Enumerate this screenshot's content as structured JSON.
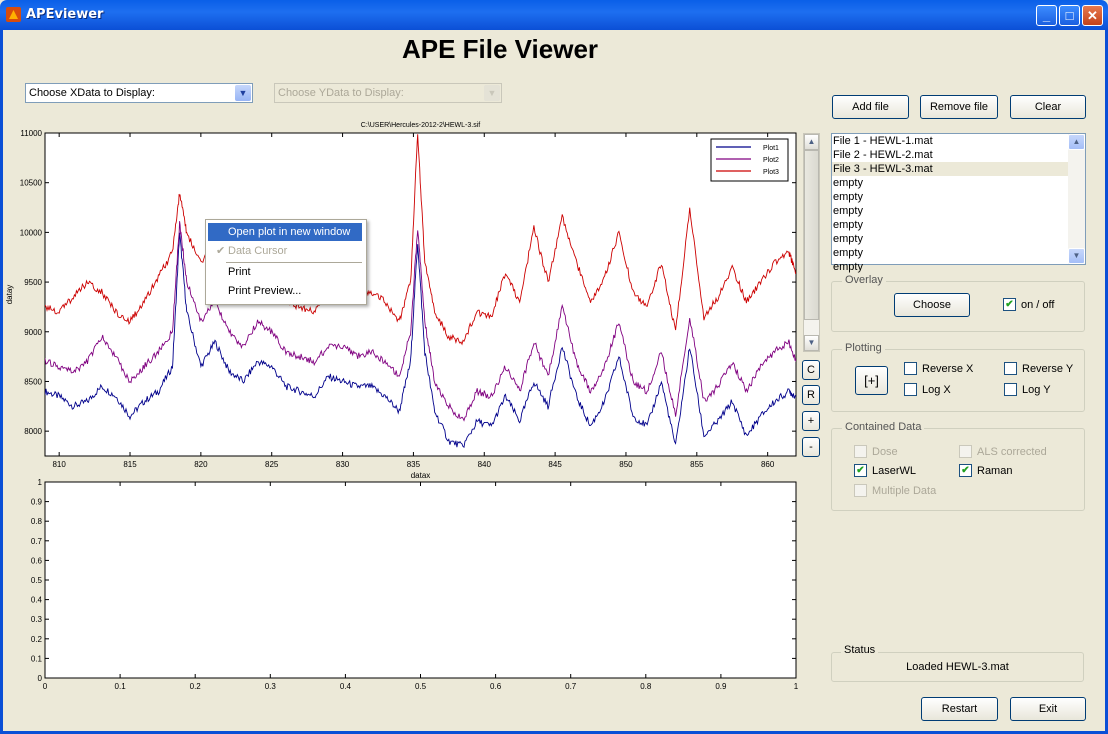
{
  "window": {
    "title": "APEviewer"
  },
  "main_title": "APE File Viewer",
  "xdata_select": {
    "value": "Choose XData to Display:"
  },
  "ydata_select": {
    "value": "Choose YData to Display:"
  },
  "buttons": {
    "add": "Add file",
    "remove": "Remove file",
    "clear": "Clear",
    "restart": "Restart",
    "exit": "Exit",
    "choose": "Choose",
    "zoom": "[+]"
  },
  "side_buttons": [
    "C",
    "R",
    "+",
    "-"
  ],
  "files": [
    "File 1 - HEWL-1.mat",
    "File 2 - HEWL-2.mat",
    "File 3 - HEWL-3.mat",
    "empty",
    "empty",
    "empty",
    "empty",
    "empty",
    "empty",
    "empty"
  ],
  "selected_file_index": 2,
  "overlay": {
    "label": "Overlay",
    "toggle_label": "on / off",
    "toggle_checked": true
  },
  "plotting": {
    "label": "Plotting",
    "reverse_x": "Reverse X",
    "reverse_y": "Reverse Y",
    "log_x": "Log X",
    "log_y": "Log Y"
  },
  "contained": {
    "label": "Contained Data",
    "dose": "Dose",
    "als": "ALS corrected",
    "laser": "LaserWL",
    "raman": "Raman",
    "multiple": "Multiple Data",
    "laser_checked": true,
    "raman_checked": true
  },
  "status": {
    "label": "Status",
    "text": "Loaded HEWL-3.mat"
  },
  "context_menu": {
    "items": [
      "Open plot in new window",
      "Data Cursor",
      "Print",
      "Print Preview..."
    ]
  },
  "colors": {
    "plot1": "#00008B",
    "plot2": "#800080",
    "plot3": "#CC0000",
    "menu_highlight": "#316AC5"
  },
  "chart_data": [
    {
      "type": "line",
      "title": "C:\\USER\\Hercules-2012-2\\HEWL-3.sif",
      "xlabel": "datax",
      "ylabel": "datay",
      "xlim": [
        809,
        862
      ],
      "ylim": [
        7750,
        11000
      ],
      "xticks": [
        810,
        815,
        820,
        825,
        830,
        835,
        840,
        845,
        850,
        855,
        860
      ],
      "yticks": [
        8000,
        8500,
        9000,
        9500,
        10000,
        10500,
        11000
      ],
      "legend": "top-right",
      "x": [
        809,
        810,
        811,
        812,
        813,
        814,
        815,
        816,
        817,
        818,
        818.5,
        819,
        820,
        821,
        822,
        823,
        824,
        825,
        826,
        827,
        828,
        829,
        830,
        831,
        832,
        833,
        834,
        834.8,
        835.3,
        835.8,
        836.5,
        837.5,
        838.5,
        839.5,
        840.5,
        841.5,
        842.5,
        843.5,
        844.5,
        845.5,
        846.5,
        847.5,
        848.5,
        849.5,
        850.5,
        851.5,
        852.5,
        853.5,
        854.5,
        855.5,
        856.5,
        857.5,
        858.5,
        859.5,
        860.5,
        861.5,
        862
      ],
      "series": [
        {
          "name": "Plot1",
          "values": [
            8400,
            8350,
            8250,
            8300,
            8450,
            8350,
            8150,
            8300,
            8400,
            8650,
            10000,
            9200,
            8650,
            8900,
            8600,
            8500,
            8700,
            8650,
            8450,
            8400,
            8350,
            8550,
            8500,
            8450,
            8450,
            8350,
            8200,
            8700,
            9900,
            8800,
            8200,
            7900,
            7850,
            8100,
            8050,
            8350,
            8100,
            8500,
            8250,
            8850,
            8350,
            8050,
            8300,
            8750,
            8150,
            8050,
            8500,
            7850,
            8850,
            7950,
            8100,
            8300,
            7950,
            8150,
            8300,
            8400,
            8350
          ]
        },
        {
          "name": "Plot2",
          "values": [
            8700,
            8650,
            8600,
            8700,
            8950,
            8750,
            8500,
            8650,
            8800,
            9000,
            10100,
            9500,
            9100,
            9300,
            9000,
            8850,
            9100,
            9000,
            8800,
            8750,
            8700,
            8850,
            8850,
            8750,
            8800,
            8700,
            8550,
            9000,
            10050,
            9100,
            8500,
            8250,
            8100,
            8400,
            8350,
            8650,
            8400,
            8900,
            8550,
            9250,
            8700,
            8400,
            8650,
            9100,
            8500,
            8400,
            8800,
            8150,
            9150,
            8300,
            8450,
            8700,
            8400,
            8650,
            8800,
            8900,
            8700
          ]
        },
        {
          "name": "Plot3",
          "values": [
            9250,
            9200,
            9350,
            9500,
            9400,
            9200,
            9100,
            9300,
            9550,
            9800,
            10400,
            10000,
            9700,
            9900,
            9500,
            9300,
            9600,
            9550,
            9300,
            9250,
            9200,
            9450,
            9450,
            9300,
            9400,
            9300,
            9100,
            9500,
            11000,
            9700,
            9200,
            8950,
            8900,
            9200,
            9150,
            9600,
            9300,
            10050,
            9500,
            10150,
            9700,
            9300,
            9550,
            10000,
            9400,
            9250,
            9700,
            9000,
            10250,
            9150,
            9350,
            9650,
            9300,
            9500,
            9700,
            9800,
            9600
          ]
        }
      ]
    },
    {
      "type": "line",
      "title": "",
      "xlim": [
        0,
        1
      ],
      "ylim": [
        0,
        1
      ],
      "xticks": [
        0,
        0.1,
        0.2,
        0.3,
        0.4,
        0.5,
        0.6,
        0.7,
        0.8,
        0.9,
        1
      ],
      "yticks": [
        0,
        0.1,
        0.2,
        0.3,
        0.4,
        0.5,
        0.6,
        0.7,
        0.8,
        0.9,
        1
      ],
      "series": []
    }
  ]
}
